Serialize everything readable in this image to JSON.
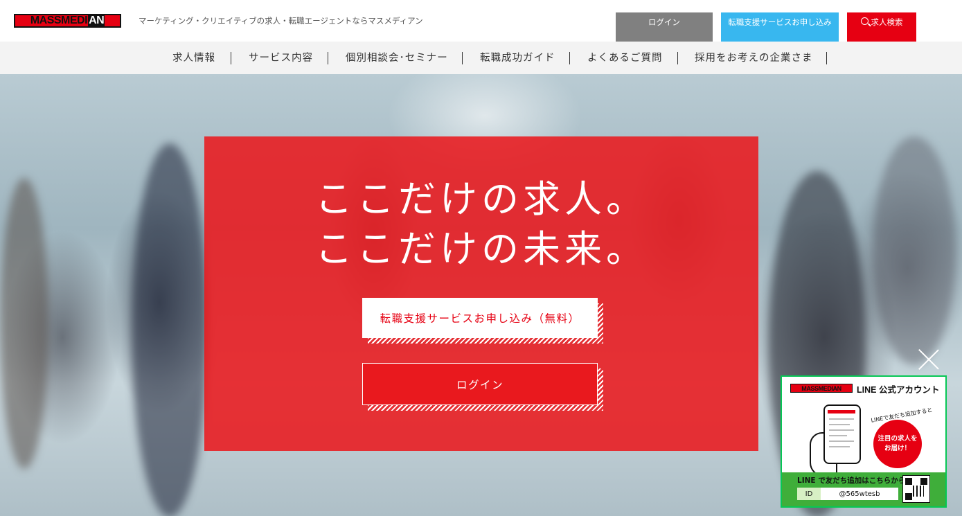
{
  "header": {
    "logo_text_main": "MASSMEDI",
    "logo_text_an": "AN",
    "tagline": "マーケティング・クリエイティブの求人・転職エージェントならマスメディアン",
    "login_label": "ログイン",
    "apply_label": "転職支援サービスお申し込み",
    "search_label": "求人検索"
  },
  "nav": {
    "items": [
      {
        "label": "求人情報"
      },
      {
        "label": "サービス内容"
      },
      {
        "label": "個別相談会･セミナー"
      },
      {
        "label": "転職成功ガイド"
      },
      {
        "label": "よくあるご質問"
      },
      {
        "label": "採用をお考えの企業さま"
      }
    ]
  },
  "hero": {
    "headline_1": "ここだけの求人。",
    "headline_2": "ここだけの未来。",
    "apply_cta": "転職支援サービスお申し込み（無料）",
    "login_cta": "ログイン"
  },
  "line_popup": {
    "brand": "MASSMEDIAN",
    "title": "LINE 公式アカウント",
    "caption": "LINEで友だち追加すると",
    "bubble_line1": "注目の求人を",
    "bubble_line2": "お届け！",
    "add_text": "LINE で友だち追加はこちらから",
    "id_label": "ID",
    "id_value": "@565wtesb",
    "qr_caption": "LINE"
  },
  "colors": {
    "brand_red": "#e60012",
    "login_gray": "#808080",
    "apply_blue": "#38b7ef",
    "line_green": "#3fae3a"
  }
}
